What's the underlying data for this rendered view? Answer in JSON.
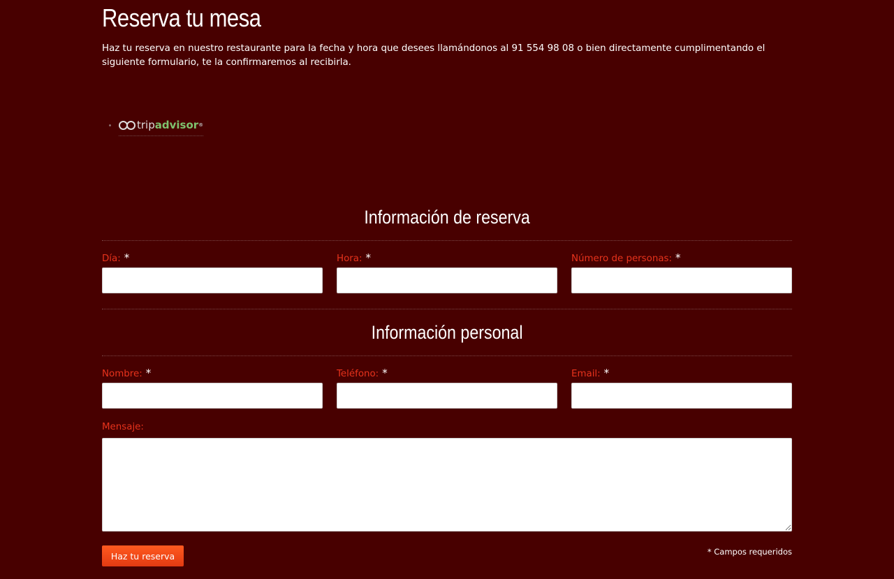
{
  "page": {
    "title": "Reserva tu mesa",
    "intro": "Haz tu reserva en nuestro restaurante para la fecha y hora que desees llamándonos al 91 554 98 08 o bien directamente cumplimentando el siguiente formulario, te la confirmaremos al recibirla."
  },
  "badges": {
    "tripadvisor": {
      "trip": "trip",
      "advisor": "advisor",
      "tm": "®"
    }
  },
  "colors": {
    "background": "#480000",
    "label": "#e8331c",
    "button": "#f04a18"
  },
  "reservation_section": {
    "title": "Información de reserva",
    "fields": [
      {
        "label": "Día:",
        "required_mark": "*",
        "value": ""
      },
      {
        "label": "Hora:",
        "required_mark": "*",
        "value": ""
      },
      {
        "label": "Número de personas:",
        "required_mark": "*",
        "value": ""
      }
    ]
  },
  "personal_section": {
    "title": "Información personal",
    "fields": [
      {
        "label": "Nombre:",
        "required_mark": "*",
        "value": ""
      },
      {
        "label": "Teléfono:",
        "required_mark": "*",
        "value": ""
      },
      {
        "label": "Email:",
        "required_mark": "*",
        "value": ""
      }
    ],
    "message": {
      "label": "Mensaje:",
      "value": ""
    }
  },
  "form": {
    "submit_label": "Haz tu reserva",
    "required_note": "* Campos requeridos"
  }
}
